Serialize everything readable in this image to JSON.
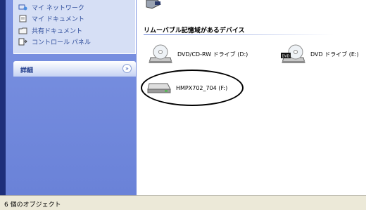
{
  "sidebar": {
    "other_places": [
      {
        "label": "マイ ネットワーク",
        "icon": "network-icon"
      },
      {
        "label": "マイ ドキュメント",
        "icon": "documents-folder-icon"
      },
      {
        "label": "共有ドキュメント",
        "icon": "shared-folder-icon"
      },
      {
        "label": "コントロール パネル",
        "icon": "control-panel-icon"
      }
    ],
    "details_title": "詳細",
    "collapse_glyph": "»"
  },
  "content": {
    "section_title": "リムーバブル記憶域があるデバイス",
    "drives": [
      {
        "label": "DVD/CD-RW ドライブ (D:)",
        "icon": "cd-drive-icon"
      },
      {
        "label": "DVD ドライブ (E:)",
        "icon": "dvd-drive-icon",
        "badge": "DVD"
      },
      {
        "label": "HMPX702_704 (F:)",
        "icon": "removable-disk-icon"
      }
    ]
  },
  "status_bar": {
    "text": "6 個のオブジェクト"
  }
}
